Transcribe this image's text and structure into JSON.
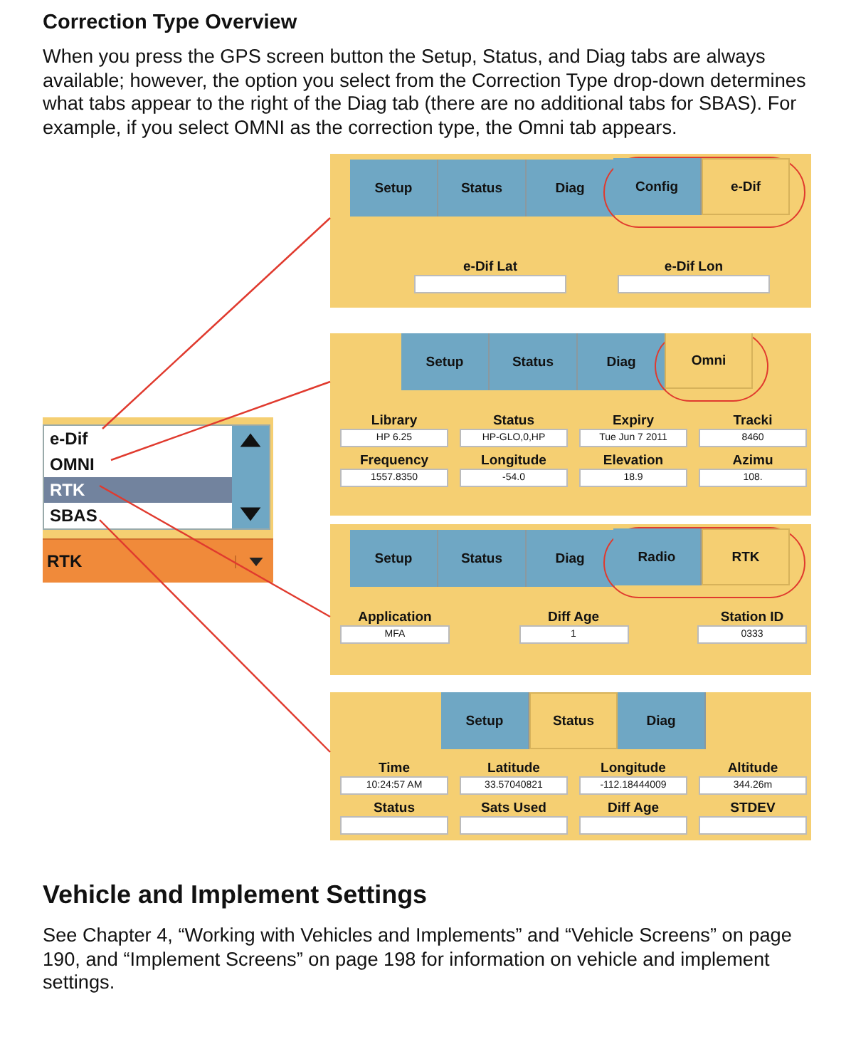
{
  "heading": "Correction Type Overview",
  "paragraph": "When you press the GPS screen button the Setup, Status, and Diag tabs are always available; however, the option you select from the Correction Type drop-down determines what tabs appear to the right of the Diag tab (there are no additional tabs for SBAS). For example, if you select OMNI as the correction type, the Omni tab appears.",
  "dropdown": {
    "items": [
      {
        "label": "e-Dif",
        "selected": false
      },
      {
        "label": "OMNI",
        "selected": false
      },
      {
        "label": "RTK",
        "selected": true
      },
      {
        "label": "SBAS",
        "selected": false
      }
    ],
    "value": "RTK"
  },
  "screens": [
    {
      "tabs": [
        {
          "label": "Setup",
          "selected": false,
          "circled": false
        },
        {
          "label": "Status",
          "selected": false,
          "circled": false
        },
        {
          "label": "Diag",
          "selected": false,
          "circled": false
        },
        {
          "label": "Config",
          "selected": false,
          "circled": true
        },
        {
          "label": "e-Dif",
          "selected": true,
          "circled": true
        }
      ],
      "rows": [
        [
          {
            "label": "e-Dif Lat"
          },
          {
            "label": "e-Dif Lon"
          }
        ]
      ]
    },
    {
      "tabs": [
        {
          "label": "Setup",
          "selected": false,
          "circled": false
        },
        {
          "label": "Status",
          "selected": false,
          "circled": false
        },
        {
          "label": "Diag",
          "selected": false,
          "circled": false
        },
        {
          "label": "Omni",
          "selected": true,
          "circled": true
        }
      ],
      "rows": [
        [
          {
            "label": "Library",
            "value": "HP 6.25"
          },
          {
            "label": "Status",
            "value": "HP-GLO,0,HP"
          },
          {
            "label": "Expiry",
            "value": "Tue Jun 7 2011"
          },
          {
            "label": "Tracki",
            "value": "8460"
          }
        ],
        [
          {
            "label": "Frequency",
            "value": "1557.8350"
          },
          {
            "label": "Longitude",
            "value": "-54.0"
          },
          {
            "label": "Elevation",
            "value": "18.9"
          },
          {
            "label": "Azimu",
            "value": "108."
          }
        ]
      ]
    },
    {
      "tabs": [
        {
          "label": "Setup",
          "selected": false,
          "circled": false
        },
        {
          "label": "Status",
          "selected": false,
          "circled": false
        },
        {
          "label": "Diag",
          "selected": false,
          "circled": false
        },
        {
          "label": "Radio",
          "selected": false,
          "circled": true
        },
        {
          "label": "RTK",
          "selected": true,
          "circled": true
        }
      ],
      "rows": [
        [
          {
            "label": "Application",
            "value": "MFA"
          },
          {
            "label": "Diff Age",
            "value": "1"
          },
          {
            "label": "Station ID",
            "value": "0333"
          }
        ]
      ]
    },
    {
      "tabs": [
        {
          "label": "Setup",
          "selected": false,
          "circled": false
        },
        {
          "label": "Status",
          "selected": true,
          "circled": false
        },
        {
          "label": "Diag",
          "selected": false,
          "circled": false
        }
      ],
      "rows": [
        [
          {
            "label": "Time",
            "value": "10:24:57 AM"
          },
          {
            "label": "Latitude",
            "value": "33.57040821"
          },
          {
            "label": "Longitude",
            "value": "-112.18444009"
          },
          {
            "label": "Altitude",
            "value": "344.26m"
          }
        ],
        [
          {
            "label": "Status"
          },
          {
            "label": "Sats Used"
          },
          {
            "label": "Diff Age"
          },
          {
            "label": "STDEV"
          }
        ]
      ]
    }
  ],
  "section_heading": "Vehicle and Implement Settings",
  "section_text": "See Chapter 4, “Working with Vehicles and Implements” and “Vehicle Screens” on page 190, and “Implement Screens” on page 198 for information on vehicle and implement settings."
}
